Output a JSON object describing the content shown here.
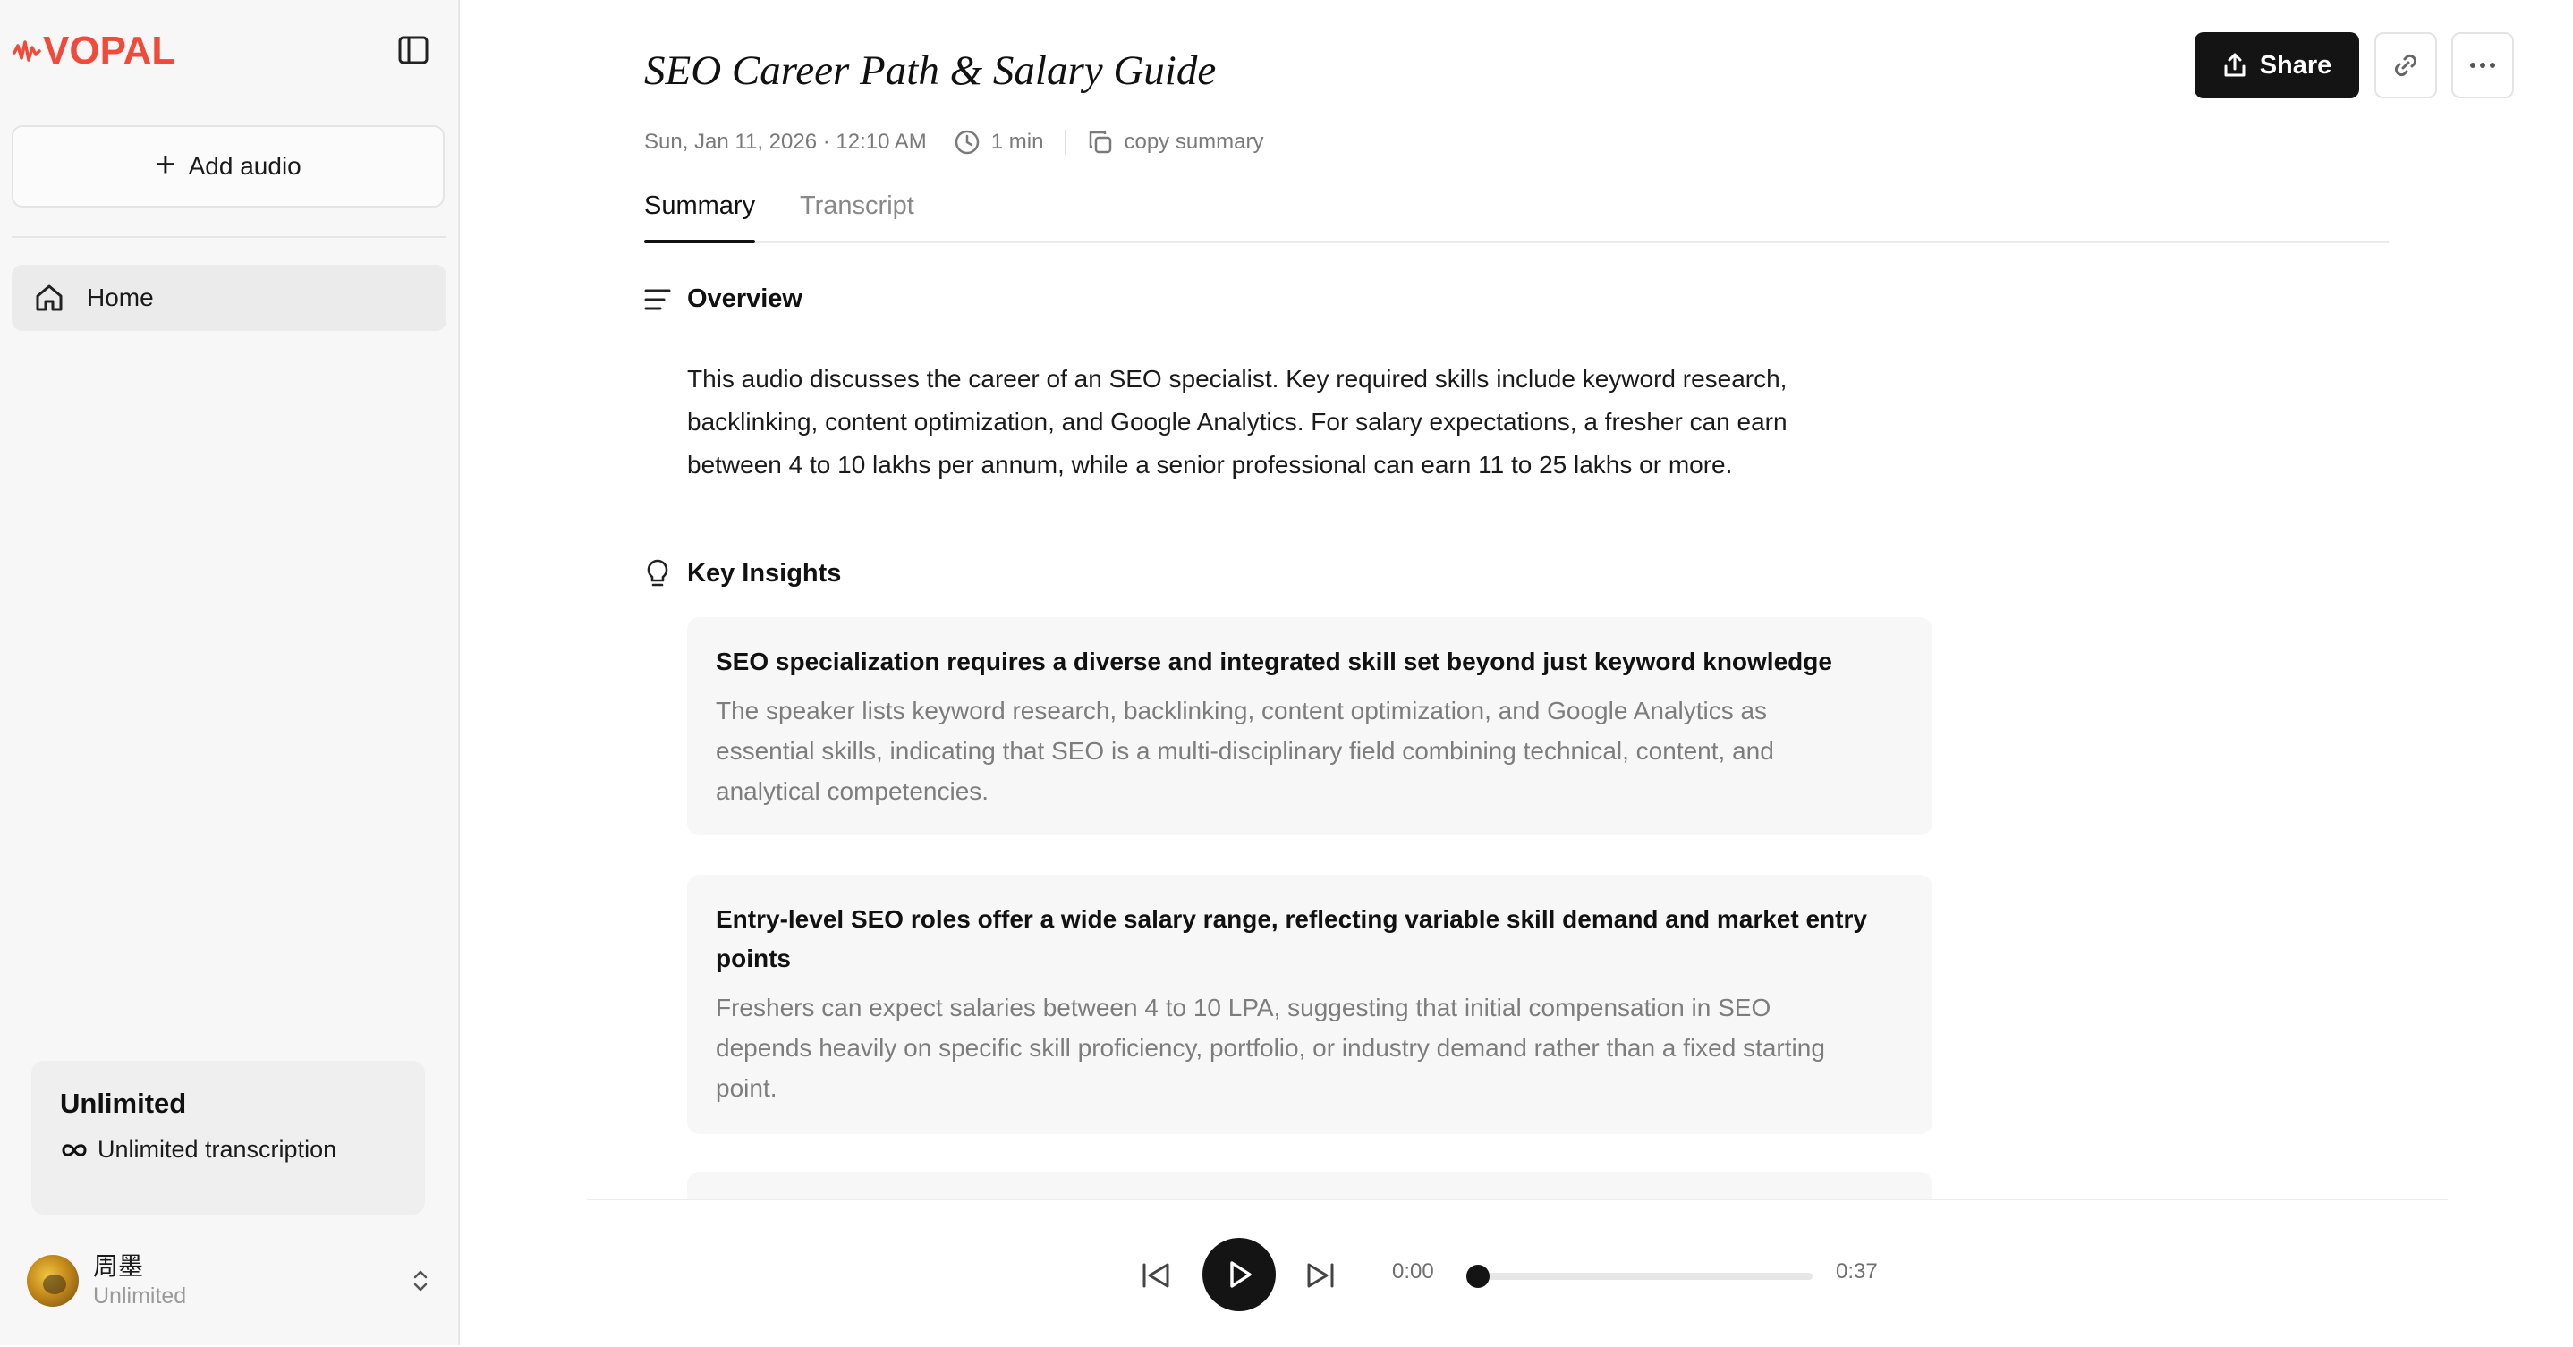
{
  "app": {
    "logo_text": "VOPAL",
    "brand_color": "#ef4a3a"
  },
  "sidebar": {
    "add_audio_label": "Add audio",
    "nav": [
      {
        "label": "Home",
        "icon": "home-icon",
        "active": true
      }
    ],
    "plan": {
      "title": "Unlimited",
      "feature": "Unlimited transcription"
    },
    "user": {
      "name": "周墨",
      "plan": "Unlimited"
    }
  },
  "header": {
    "title": "SEO Career Path & Salary Guide",
    "share_label": "Share",
    "meta": {
      "datetime": "Sun, Jan 11, 2026 · 12:10 AM",
      "duration": "1 min",
      "copy_label": "copy summary"
    }
  },
  "tabs": [
    {
      "label": "Summary",
      "active": true
    },
    {
      "label": "Transcript",
      "active": false
    }
  ],
  "overview": {
    "heading": "Overview",
    "lines": [
      "This audio discusses the career of an SEO specialist. Key required skills include keyword research,",
      "backlinking, content optimization, and Google Analytics. For salary expectations, a fresher can earn",
      "between 4 to 10 lakhs per annum, while a senior professional can earn 11 to 25 lakhs or more."
    ]
  },
  "insights": {
    "heading": "Key Insights",
    "items": [
      {
        "title": "SEO specialization requires a diverse and integrated skill set beyond just keyword knowledge",
        "desc_lines": [
          "The speaker lists keyword research, backlinking, content optimization, and Google Analytics as",
          "essential skills, indicating that SEO is a multi-disciplinary field combining technical, content, and",
          "analytical competencies."
        ]
      },
      {
        "title_lines": [
          "Entry-level SEO roles offer a wide salary range, reflecting variable skill demand and market entry",
          "points"
        ],
        "desc_lines": [
          "Freshers can expect salaries between 4 to 10 LPA, suggesting that initial compensation in SEO",
          "depends heavily on specific skill proficiency, portfolio, or industry demand rather than a fixed starting",
          "point."
        ]
      }
    ]
  },
  "player": {
    "current": "0:00",
    "total": "0:37",
    "progress": 0.0
  }
}
